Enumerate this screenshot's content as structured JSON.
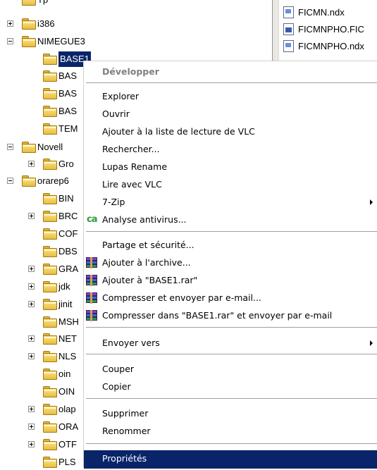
{
  "tree": {
    "items": [
      {
        "label": "Tp",
        "expander": "none"
      },
      {
        "label": "i386",
        "expander": "plus"
      },
      {
        "label": "NIMEGUE3",
        "expander": "minus"
      },
      {
        "label": "BASE1",
        "expander": "none",
        "selected": true
      },
      {
        "label": "BAS",
        "expander": "none"
      },
      {
        "label": "BAS",
        "expander": "none"
      },
      {
        "label": "BAS",
        "expander": "none"
      },
      {
        "label": "TEM",
        "expander": "none"
      },
      {
        "label": "Novell",
        "expander": "minus"
      },
      {
        "label": "Gro",
        "expander": "plus"
      },
      {
        "label": "orarep6",
        "expander": "minus"
      },
      {
        "label": "BIN",
        "expander": "none"
      },
      {
        "label": "BRC",
        "expander": "plus"
      },
      {
        "label": "COF",
        "expander": "none"
      },
      {
        "label": "DBS",
        "expander": "none"
      },
      {
        "label": "GRA",
        "expander": "plus"
      },
      {
        "label": "jdk",
        "expander": "plus"
      },
      {
        "label": "jinit",
        "expander": "plus"
      },
      {
        "label": "MSH",
        "expander": "none"
      },
      {
        "label": "NET",
        "expander": "plus"
      },
      {
        "label": "NLS",
        "expander": "plus"
      },
      {
        "label": "oin",
        "expander": "none"
      },
      {
        "label": "OIN",
        "expander": "none"
      },
      {
        "label": "olap",
        "expander": "plus"
      },
      {
        "label": "ORA",
        "expander": "plus"
      },
      {
        "label": "OTF",
        "expander": "plus"
      },
      {
        "label": "PLS",
        "expander": "none"
      }
    ]
  },
  "files": [
    {
      "name": "FICMN.ndx",
      "icon": "ndx-file-icon"
    },
    {
      "name": "FICMNPHO.FIC",
      "icon": "fic-file-icon"
    },
    {
      "name": "FICMNPHO.ndx",
      "icon": "ndx-file-icon"
    }
  ],
  "context_menu": {
    "items": [
      {
        "type": "item",
        "label": "Développer",
        "disabled": true
      },
      {
        "type": "separator"
      },
      {
        "type": "item",
        "label": "Explorer"
      },
      {
        "type": "item",
        "label": "Ouvrir"
      },
      {
        "type": "item",
        "label": "Ajouter à la liste de lecture de VLC"
      },
      {
        "type": "item",
        "label": "Rechercher..."
      },
      {
        "type": "item",
        "label": "Lupas Rename"
      },
      {
        "type": "item",
        "label": "Lire avec VLC"
      },
      {
        "type": "item",
        "label": "7-Zip",
        "submenu": true
      },
      {
        "type": "item",
        "label": "Analyse antivirus...",
        "icon": "ca-antivirus-icon"
      },
      {
        "type": "separator"
      },
      {
        "type": "item",
        "label": "Partage et sécurité..."
      },
      {
        "type": "item",
        "label": "Ajouter à l'archive...",
        "icon": "winrar-icon"
      },
      {
        "type": "item",
        "label": "Ajouter à \"BASE1.rar\"",
        "icon": "winrar-icon"
      },
      {
        "type": "item",
        "label": "Compresser et envoyer par e-mail...",
        "icon": "winrar-icon"
      },
      {
        "type": "item",
        "label": "Compresser dans \"BASE1.rar\" et envoyer par e-mail",
        "icon": "winrar-icon"
      },
      {
        "type": "separator"
      },
      {
        "type": "item",
        "label": "Envoyer vers",
        "submenu": true
      },
      {
        "type": "separator"
      },
      {
        "type": "item",
        "label": "Couper"
      },
      {
        "type": "item",
        "label": "Copier"
      },
      {
        "type": "separator"
      },
      {
        "type": "item",
        "label": "Supprimer"
      },
      {
        "type": "item",
        "label": "Renommer"
      },
      {
        "type": "separator"
      },
      {
        "type": "item",
        "label": "Propriétés",
        "highlighted": true
      }
    ],
    "ca_icon_text": "ca"
  },
  "colors": {
    "selection": "#0a246a",
    "folder": "#e8bd3c",
    "disabled_text": "#808080"
  }
}
